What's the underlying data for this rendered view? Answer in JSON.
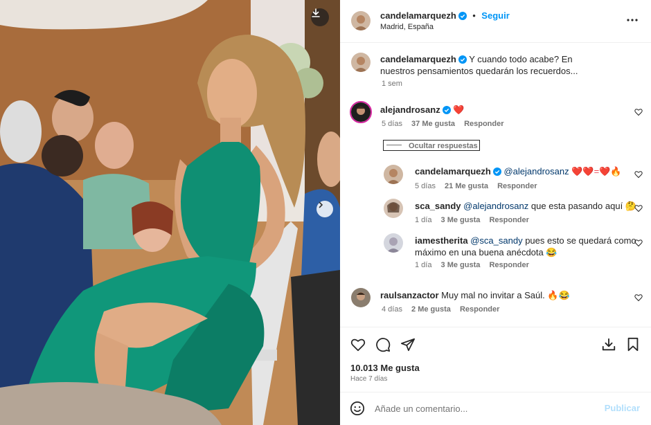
{
  "post": {
    "author": "candelamarquezh",
    "follow_label": "Seguir",
    "location": "Madrid, España",
    "caption": "Y cuando todo acabe? En nuestros pensamientos quedarán los recuerdos...",
    "caption_time": "1 sem",
    "likes": "10.013 Me gusta",
    "posted": "Hace 7 días"
  },
  "comments": [
    {
      "user": "alejandrosanz",
      "verified": true,
      "text": "❤️",
      "time": "5 días",
      "likes": "37 Me gusta",
      "reply": "Responder",
      "hide_replies": "Ocultar respuestas"
    },
    {
      "user": "candelamarquezh",
      "verified": true,
      "mention": "@alejandrosanz",
      "text": "❤️❤️=❤️🔥",
      "time": "5 días",
      "likes": "21 Me gusta",
      "reply": "Responder"
    },
    {
      "user": "sca_sandy",
      "mention": "@alejandrosanz",
      "text": "que esta pasando aquí 🤔",
      "time": "1 día",
      "likes": "3 Me gusta",
      "reply": "Responder"
    },
    {
      "user": "iamestherita",
      "mention": "@sca_sandy",
      "text_line1": "pues esto se quedará como",
      "text_line2": "máximo en una buena anécdota 😂",
      "time": "1 día",
      "likes": "3 Me gusta",
      "reply": "Responder"
    },
    {
      "user": "raulsanzactor",
      "text": "Muy mal no invitar a Saúl. 🔥😂",
      "time": "4 días",
      "likes": "2 Me gusta",
      "reply": "Responder"
    }
  ],
  "composer": {
    "placeholder": "Añade un comentario...",
    "publish_label": "Publicar"
  },
  "colors": {
    "accent": "#0095f6",
    "verified": "#0095f6",
    "heart": "#ed4956",
    "dress": "#0f8f73"
  }
}
